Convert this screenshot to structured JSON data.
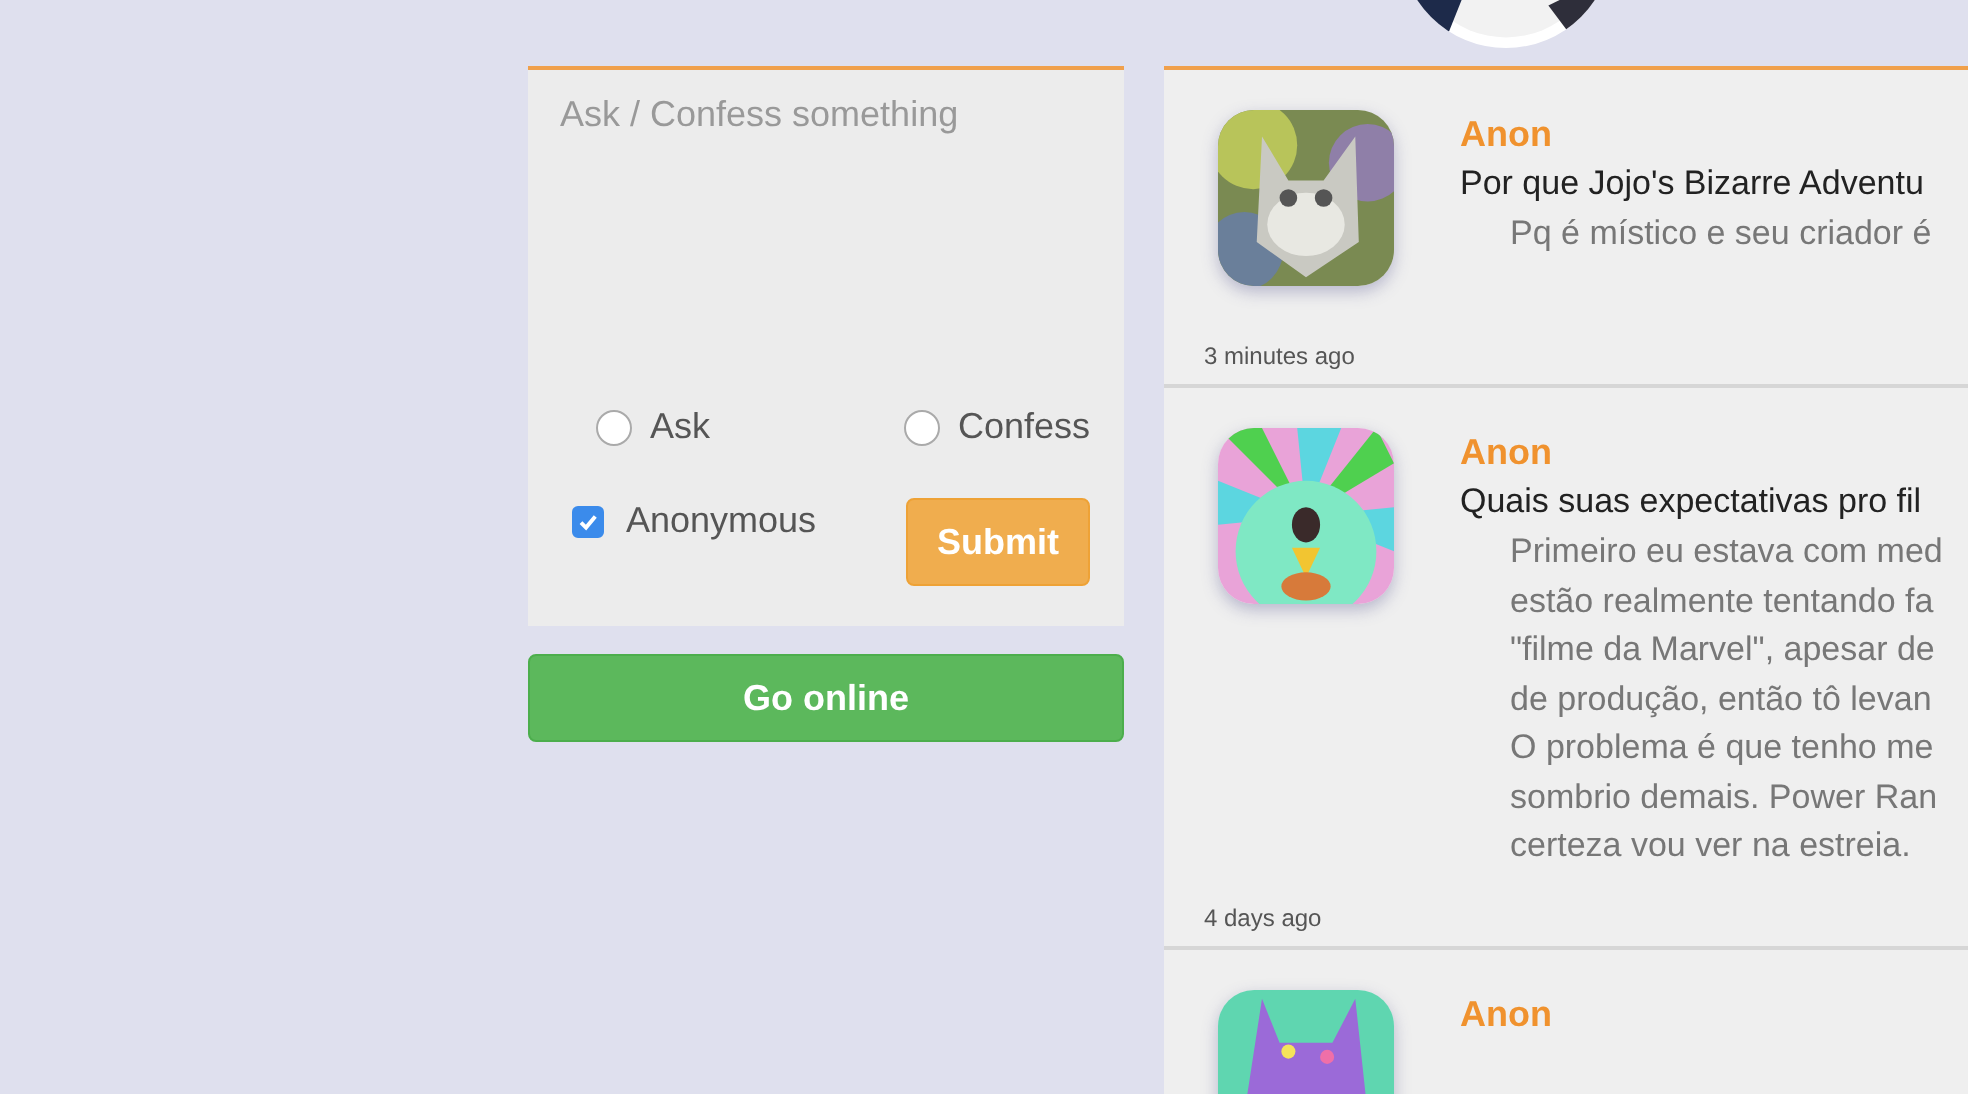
{
  "compose": {
    "placeholder": "Ask / Confess something",
    "post_types": [
      {
        "label": "Ask",
        "selected": false
      },
      {
        "label": "Confess",
        "selected": false
      }
    ],
    "anonymous": {
      "label": "Anonymous",
      "checked": true
    },
    "submit": "Submit"
  },
  "go_online": "Go online",
  "posts": [
    {
      "author": "Anon",
      "question": "Por que Jojo's Bizarre Adventu",
      "reply_lines": [
        "Pq é místico e seu criador é"
      ],
      "time": "3 minutes ago"
    },
    {
      "author": "Anon",
      "question": "Quais suas expectativas pro fil",
      "reply_lines": [
        "Primeiro eu estava com med",
        "estão realmente tentando fa",
        "\"filme da Marvel\", apesar de",
        "de produção, então tô levan",
        "O problema é que tenho me",
        "sombrio demais. Power Ran",
        "certeza vou ver na estreia."
      ],
      "time": "4 days ago"
    },
    {
      "author": "Anon"
    }
  ]
}
